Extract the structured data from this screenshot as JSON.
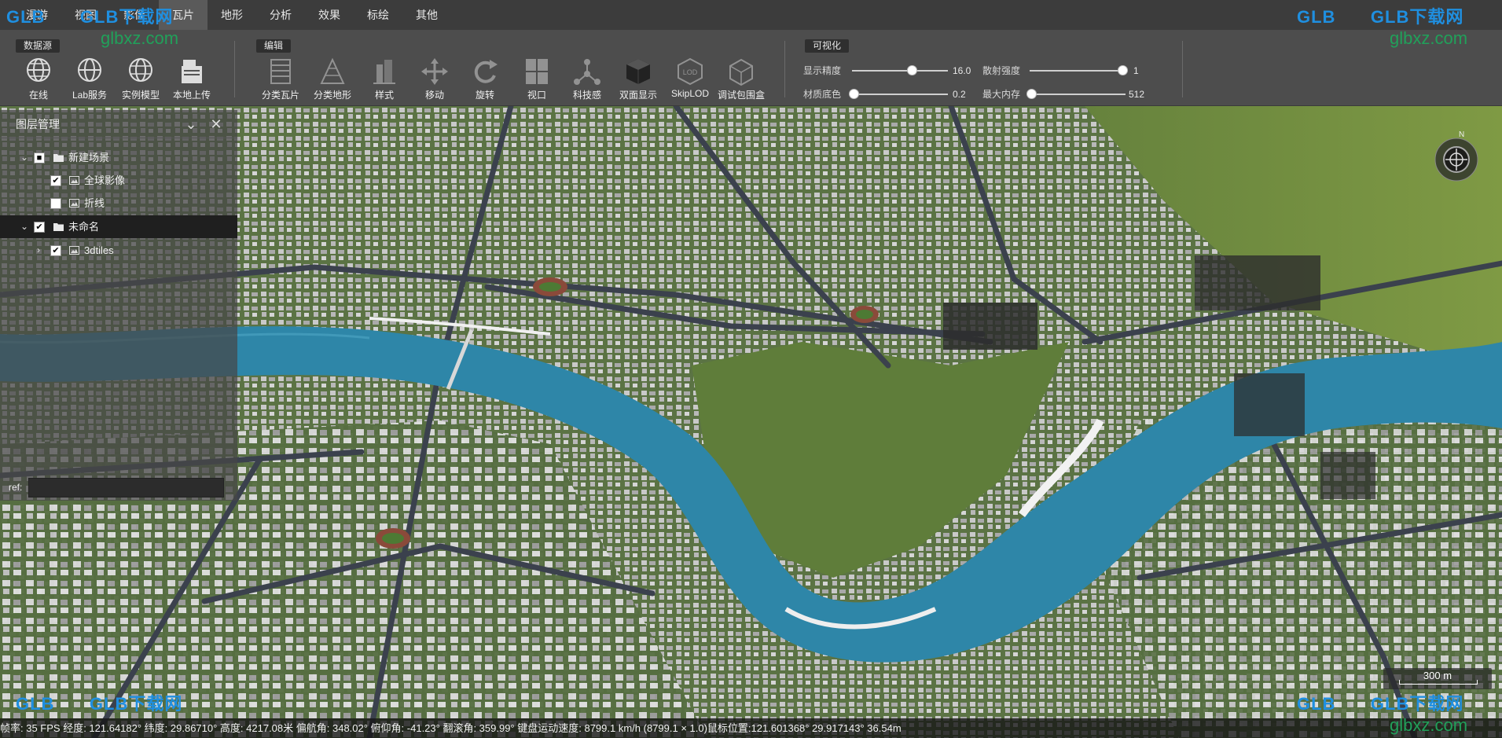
{
  "menu": [
    "漫游",
    "视图",
    "影像",
    "瓦片",
    "地形",
    "分析",
    "效果",
    "标绘",
    "其他"
  ],
  "menu_active": "瓦片",
  "toolbar": {
    "groups": [
      "数据源",
      "编辑",
      "可视化"
    ],
    "datasource_tools": [
      "在线",
      "Lab服务",
      "实例模型",
      "本地上传"
    ],
    "edit_tools": [
      "分类瓦片",
      "分类地形",
      "样式",
      "移动",
      "旋转",
      "视口",
      "科技感",
      "双面显示",
      "SkipLOD",
      "调试包围盒"
    ],
    "sliders": {
      "display_precision": {
        "label": "显示精度",
        "value": "16.0",
        "fraction": 0.64
      },
      "scatter_intensity": {
        "label": "散射强度",
        "value": "1",
        "fraction": 1.0
      },
      "material_base_color": {
        "label": "材质底色",
        "value": "0.2",
        "fraction": 0.0
      },
      "max_memory": {
        "label": "最大内存",
        "value": "512",
        "fraction": 0.0
      }
    }
  },
  "layer_panel": {
    "title": "图层管理",
    "items": [
      {
        "label": "新建场景",
        "checked": "■"
      },
      {
        "label": "全球影像",
        "checked": "✔"
      },
      {
        "label": "折线",
        "checked": ""
      },
      {
        "label": "未命名",
        "checked": "✔"
      },
      {
        "label": "3dtiles",
        "checked": "✔"
      }
    ],
    "ref_label": "ref:"
  },
  "status": "帧率: 35 FPS 经度: 121.64182° 纬度: 29.86710° 高度: 4217.08米 偏航角: 348.02° 俯仰角: -41.23° 翻滚角: 359.99° 键盘运动速度: 8799.1 km/h (8799.1 × 1.0)鼠标位置:121.601368° 29.917143° 36.54m",
  "compass_label": "N",
  "scale_label": "300 m",
  "watermark": {
    "brand": "GLB下载网",
    "site": "glbxz.com",
    "logo": "GLB"
  },
  "colors": {
    "river": "#2e86a8",
    "land": "#4d6d34",
    "road": "#3a4150",
    "building": "#cfcfcf"
  }
}
